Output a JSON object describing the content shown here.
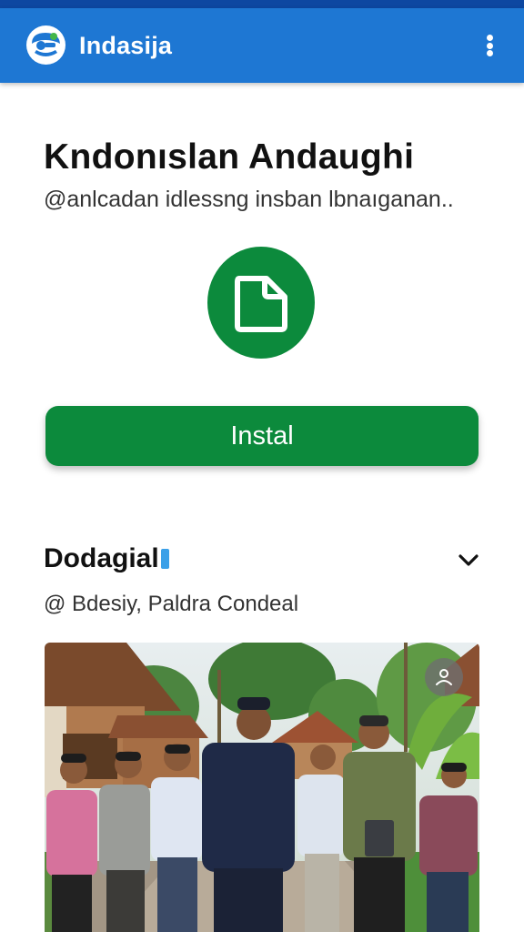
{
  "app_bar": {
    "title": "Indasija",
    "logo_icon": "app-logo-icon",
    "menu_icon": "more-vert-icon",
    "color": "#1e77d3"
  },
  "hero": {
    "title": "Kndonıslan Andaughi",
    "subtitle": "@anlcadan idlessng insban lbnaıganan..",
    "icon": "document-icon",
    "icon_bg": "#0c8a3c"
  },
  "install_button": {
    "label": "Instal",
    "color": "#0c8a3c"
  },
  "section": {
    "title": "Dodagial",
    "location": "@ Bdesiy, Paldra Condeal",
    "chevron_icon": "chevron-down-icon"
  },
  "photo": {
    "overlay_icon": "person-icon"
  }
}
